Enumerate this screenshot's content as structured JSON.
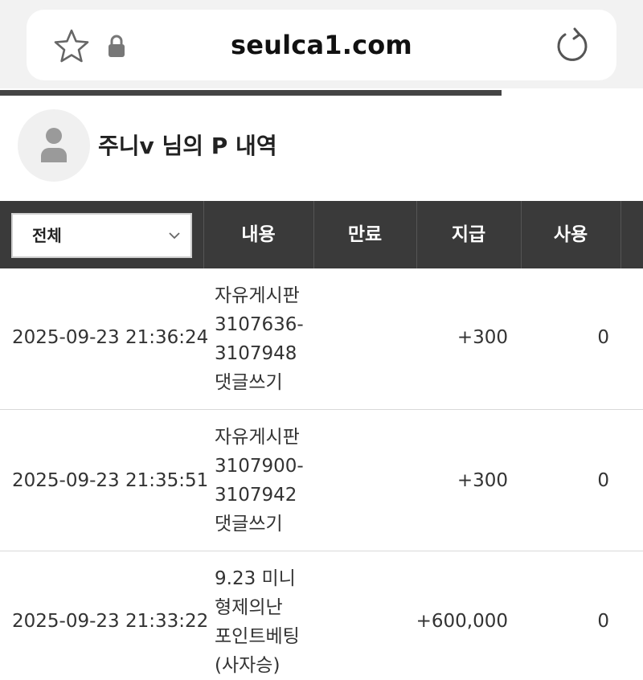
{
  "browser": {
    "url": "seulca1.com",
    "progress": 0.78
  },
  "header": {
    "title": "주니v 님의 P 내역"
  },
  "table": {
    "filter": {
      "selected": "전체"
    },
    "columns": [
      "내용",
      "만료",
      "지급",
      "사용"
    ],
    "rows": [
      {
        "date": "2025-09-23 21:36:24",
        "content": [
          "자유게시판",
          "3107636-",
          "3107948",
          "댓글쓰기"
        ],
        "expire": "",
        "pay": "+300",
        "used": "0"
      },
      {
        "date": "2025-09-23 21:35:51",
        "content": [
          "자유게시판",
          "3107900-",
          "3107942",
          "댓글쓰기"
        ],
        "expire": "",
        "pay": "+300",
        "used": "0"
      },
      {
        "date": "2025-09-23 21:33:22",
        "content": [
          "9.23 미니",
          "형제의난",
          "포인트베팅",
          "(사자승)"
        ],
        "expire": "",
        "pay": "+600,000",
        "used": "0"
      }
    ]
  },
  "icons": {
    "star": "star-outline-icon",
    "lock": "lock-icon",
    "reload": "reload-icon",
    "avatar": "user-icon",
    "chevron": "chevron-down-icon"
  }
}
